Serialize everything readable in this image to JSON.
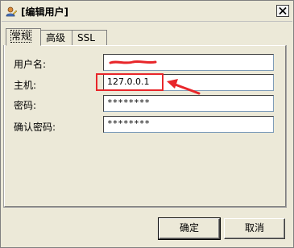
{
  "window": {
    "title": "[编辑用户]"
  },
  "tabs": [
    {
      "label": "常规",
      "active": true
    },
    {
      "label": "高级",
      "active": false
    },
    {
      "label": "SSL",
      "active": false
    }
  ],
  "form": {
    "username": {
      "label": "用户名:",
      "value": ""
    },
    "host": {
      "label": "主机:",
      "value": "127.0.0.1"
    },
    "password": {
      "label": "密码:",
      "value": "********"
    },
    "confirm_password": {
      "label": "确认密码:",
      "value": "********"
    }
  },
  "buttons": {
    "ok": "确定",
    "cancel": "取消"
  },
  "annotation": {
    "color": "#e8262a"
  },
  "icons": {
    "app": "user-edit-icon",
    "close": "close-icon"
  }
}
